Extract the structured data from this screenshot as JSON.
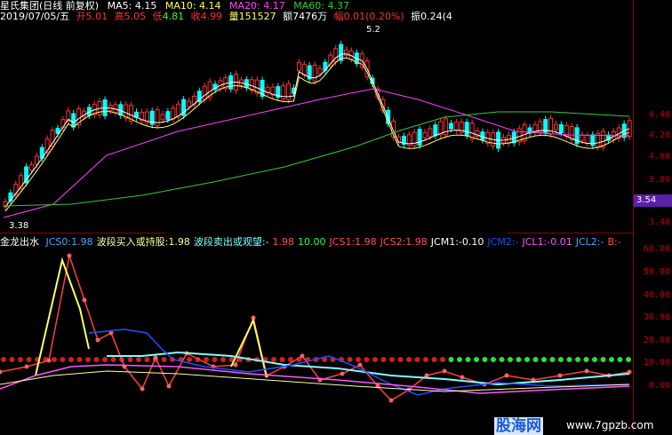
{
  "header": {
    "title": "星氏集团(日线 前复权)",
    "ma5_label": "MA5:",
    "ma5": "4.15",
    "ma10_label": "MA10:",
    "ma10": "4.14",
    "ma20_label": "MA20:",
    "ma20": "4.17",
    "ma60_label": "MA60:",
    "ma60": "4.37"
  },
  "quote": {
    "date": "2019/07/05/五",
    "open_label": "开",
    "open": "5.01",
    "high_label": "高",
    "high": "5.05",
    "low_label": "低",
    "low": "4.81",
    "close_label": "收",
    "close": "4.99",
    "vol_label": "量",
    "vol": "151527",
    "amount_label": "额",
    "amount": "7476万",
    "chg_label": "幅",
    "chg": "0.01(0.20%)",
    "amp_label": "振",
    "amp": "0.24(4"
  },
  "annotations": {
    "high_marker": "5.2",
    "low_marker": "3.38"
  },
  "price_axis": [
    "4.40",
    "4.20",
    "4.00",
    "3.80",
    "3.40"
  ],
  "current_price": "3.54",
  "indicator": {
    "name": "金龙出水",
    "items": [
      {
        "label": "JCS0:",
        "value": "1.98",
        "color": "#4fa3ff"
      },
      {
        "label": "波段买入或持股:",
        "value": "1.98",
        "color": "#ffffa0"
      },
      {
        "label": "波段卖出或观望:",
        "value": "-",
        "color": "#7fffff"
      },
      {
        "label": "",
        "value": "1.98",
        "color": "#ff5050"
      },
      {
        "label": "",
        "value": "10.00",
        "color": "#33ff33"
      },
      {
        "label": "JCS1:",
        "value": "1.98",
        "color": "#ff5050"
      },
      {
        "label": "JCS2:",
        "value": "1.98",
        "color": "#ff5050"
      },
      {
        "label": "JCM1:",
        "value": "-0.10",
        "color": "#ffffff"
      },
      {
        "label": "JCM2:",
        "value": "-",
        "color": "#2050ff"
      },
      {
        "label": "JCL1:",
        "value": "-0.01",
        "color": "#ff55ff"
      },
      {
        "label": "JCL2:",
        "value": "-",
        "color": "#4fa3ff"
      },
      {
        "label": "B:",
        "value": "-",
        "color": "#ff5050"
      }
    ]
  },
  "indicator_axis": [
    "60.00",
    "50.00",
    "40.00",
    "30.00",
    "20.00",
    "10.00",
    "0.00"
  ],
  "watermark": {
    "logo": "股海网",
    "url": "www.7gpzb.com"
  },
  "colors": {
    "up": "#ff3030",
    "down": "#00ffff",
    "ma5": "#ffffff",
    "ma10": "#ffff60",
    "ma20": "#ff40ff",
    "ma60": "#33cc33",
    "axis": "#8b0000"
  }
}
